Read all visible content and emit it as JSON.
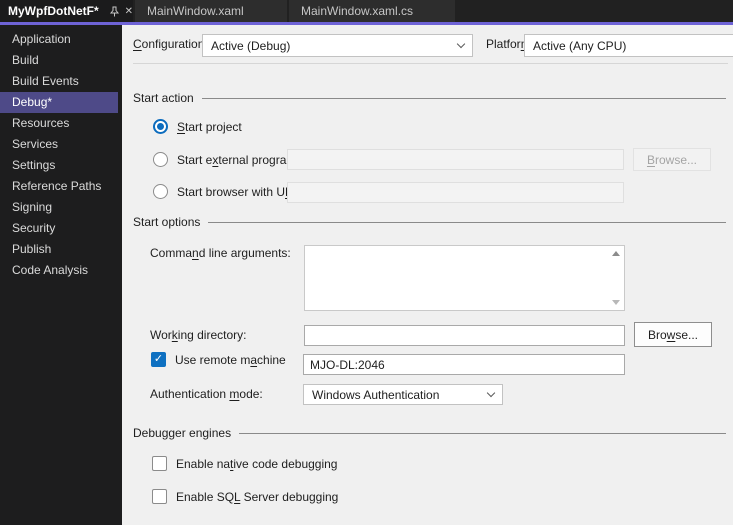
{
  "icons": {
    "close": "✕",
    "check": "✓"
  },
  "colors": {
    "accent_line": "#6E63D6",
    "sidebar_selected": "#4E4A88",
    "control_accent": "#0C6CBE"
  },
  "tabs": {
    "items": [
      {
        "label": "MyWpfDotNetF*",
        "active": true
      },
      {
        "label": "MainWindow.xaml",
        "active": false
      },
      {
        "label": "MainWindow.xaml.cs",
        "active": false
      }
    ]
  },
  "sidebar": {
    "items": [
      {
        "label": "Application"
      },
      {
        "label": "Build"
      },
      {
        "label": "Build Events"
      },
      {
        "label": "Debug*"
      },
      {
        "label": "Resources"
      },
      {
        "label": "Services"
      },
      {
        "label": "Settings"
      },
      {
        "label": "Reference Paths"
      },
      {
        "label": "Signing"
      },
      {
        "label": "Security"
      },
      {
        "label": "Publish"
      },
      {
        "label": "Code Analysis"
      }
    ],
    "selected_index": 3
  },
  "config_row": {
    "configuration_label": {
      "text": "Configuration:",
      "u": 0
    },
    "configuration_value": "Active (Debug)",
    "platform_label": {
      "text": "Platform:",
      "u": 7
    },
    "platform_value": "Active (Any CPU)"
  },
  "start_action": {
    "title": "Start action",
    "start_project": {
      "label": {
        "text": "Start project",
        "u": 0
      },
      "selected": true
    },
    "start_external": {
      "label": {
        "text": "Start external program:",
        "u": 7
      },
      "selected": false,
      "value": "",
      "browse": {
        "text": "Browse...",
        "u": 0
      },
      "enabled": false
    },
    "start_browser": {
      "label": {
        "text": "Start browser with URL:",
        "u": 20
      },
      "selected": false,
      "value": ""
    }
  },
  "start_options": {
    "title": "Start options",
    "command_line": {
      "label": {
        "text": "Command line arguments:",
        "u": 5
      },
      "value": ""
    },
    "working_dir": {
      "label": {
        "text": "Working directory:",
        "u": 3
      },
      "value": "",
      "browse": {
        "text": "Browse...",
        "u": 3
      }
    },
    "remote": {
      "label": {
        "text": "Use remote machine",
        "u": 12
      },
      "checked": true,
      "value": "MJO-DL:2046"
    },
    "auth": {
      "label": {
        "text": "Authentication mode:",
        "u": 15
      },
      "value": "Windows Authentication"
    }
  },
  "debugger_engines": {
    "title": "Debugger engines",
    "native": {
      "label": {
        "text": "Enable native code debugging",
        "u": 9
      },
      "checked": false
    },
    "sql": {
      "label": {
        "text": "Enable SQL Server debugging",
        "u": 9
      },
      "checked": false
    }
  }
}
